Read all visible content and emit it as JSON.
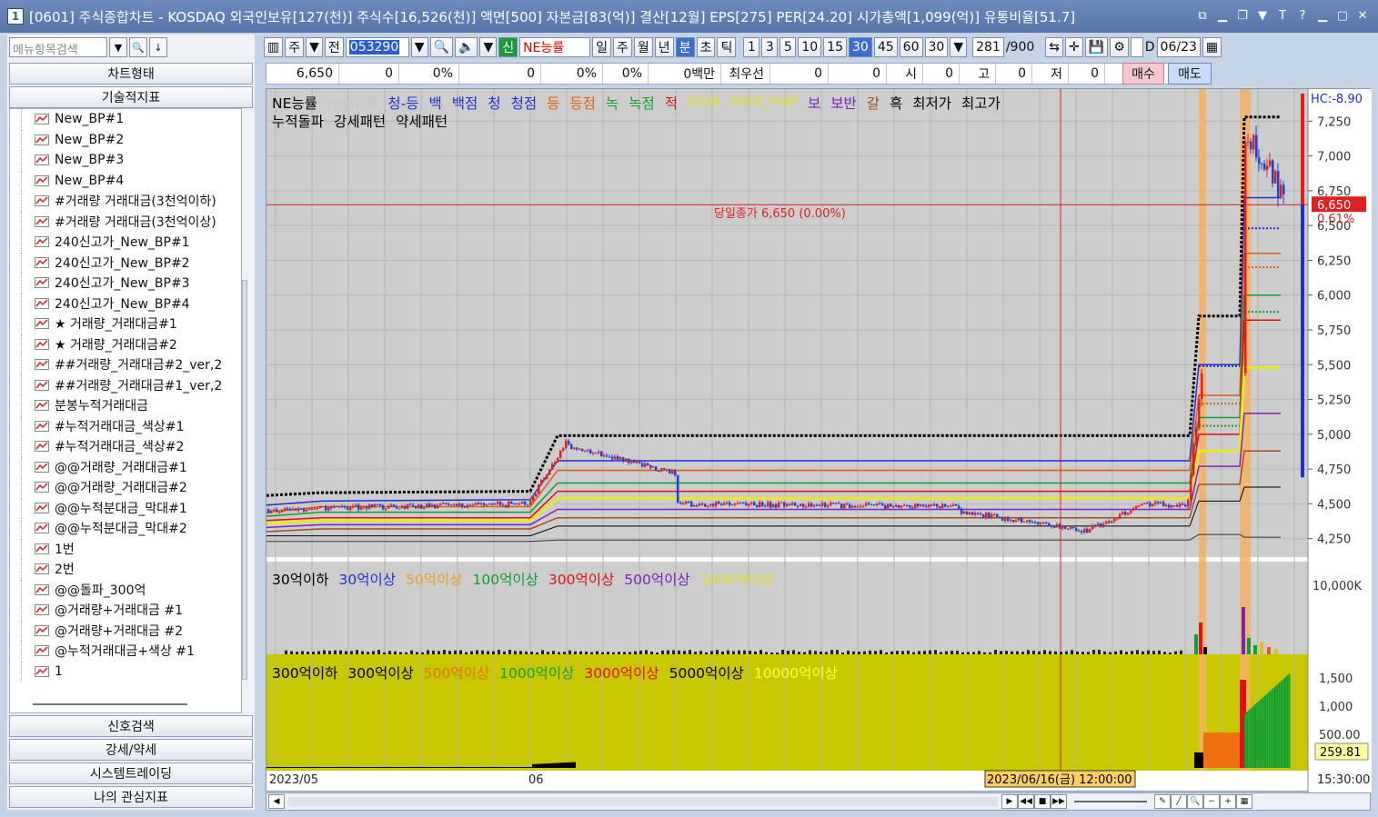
{
  "titlebar": {
    "badge": "1",
    "text": "[0601] 주식종합차트 - KOSDAQ 외국인보유[127(천)] 주식수[16,526(천)] 액면[500] 자본금[83(억)] 결산[12월] EPS[275] PER[24.20] 시가총액[1,099(억)] 유통비율[51.7]",
    "controls": [
      "⧉",
      "▁",
      "❐",
      "▼",
      "T",
      "?",
      "▁",
      "▢",
      "✕"
    ]
  },
  "leftpanel": {
    "search_placeholder": "메뉴항목검색",
    "chart_type_label": "차트형태",
    "tech_indicator_label": "기술적지표",
    "indicators": [
      "New_BP#1",
      "New_BP#2",
      "New_BP#3",
      "New_BP#4",
      "#거래량 거래대금(3천억이하)",
      "#거래량 거래대금(3천억이상)",
      "240신고가_New_BP#1",
      "240신고가_New_BP#2",
      "240신고가_New_BP#3",
      "240신고가_New_BP#4",
      "★ 거래량_거래대금#1",
      "★ 거래량_거래대금#2",
      "##거래량_거래대금#2_ver,2",
      "##거래량_거래대금#1_ver,2",
      "분봉누적거래대금",
      "#누적거래대금_색상#1",
      "#누적거래대금_색상#2",
      "@@거래량_거래대금#1",
      "@@거래량_거래대금#2",
      "@@누적분대금_막대#1",
      "@@누적분대금_막대#2",
      "1번",
      "2번",
      "@@돌파_300억",
      "@거래량+거래대금 #1",
      "@거래량+거래대금 #2",
      "@누적거래대금+색상 #1",
      "1"
    ],
    "bottom_buttons": [
      "신호검색",
      "강세/약세",
      "시스템트레이딩",
      "나의 관심지표"
    ]
  },
  "toolbar": {
    "stock_type": "주",
    "prev": "전",
    "code": "053290",
    "credit": "신",
    "indicator_name": "NE능률",
    "periods": [
      "일",
      "주",
      "월",
      "년",
      "분",
      "초",
      "틱"
    ],
    "active_period": "분",
    "intervals": [
      "1",
      "3",
      "5",
      "10",
      "15",
      "30",
      "45",
      "60"
    ],
    "active_interval": "30",
    "interval_select": "30",
    "count": "281",
    "count_total": "/900",
    "date_label": "D",
    "date_value": "06/23"
  },
  "pricebar": {
    "cells": [
      "6,650",
      "0",
      "0%",
      "0",
      "0%",
      "0%",
      "0백만",
      "최우선",
      "0",
      "0",
      "시",
      "0",
      "고",
      "0",
      "저",
      "0"
    ],
    "buy": "매수",
    "sell": "매도"
  },
  "chart": {
    "legend_top": [
      "NE능률",
      "High-청",
      "청-등",
      "백",
      "백점",
      "청",
      "청점",
      "등",
      "등점",
      "녹",
      "녹점",
      "적",
      "Gold",
      "Gold_Half",
      "보",
      "보반",
      "갈",
      "흑",
      "최저가",
      "최고가"
    ],
    "legend_top_colors": [
      "#000000",
      "#c8c8c8",
      "#2030d0",
      "#2030d0",
      "#2030d0",
      "#2030d0",
      "#2030d0",
      "#e06010",
      "#e06010",
      "#10a030",
      "#10a030",
      "#e01010",
      "#e0e020",
      "#e0e020",
      "#8020c0",
      "#8020c0",
      "#a05020",
      "#000000",
      "#000000",
      "#000000"
    ],
    "legend_top2": [
      "누적돌파",
      "강세패턴",
      "약세패턴"
    ],
    "close_label": "당일종가 6,650 (0.00%)",
    "hc_label": "HC:-8.90",
    "price_ticks": [
      "7,250",
      "7,000",
      "6,750",
      "6,500",
      "6,250",
      "6,000",
      "5,750",
      "5,500",
      "5,250",
      "5,000",
      "4,750",
      "4,500",
      "4,250"
    ],
    "price_box": "6,650",
    "pct_box": "0.61%",
    "legend_mid": [
      "30억이하",
      "30억이상",
      "50억이상",
      "100억이상",
      "300억이상",
      "500억이상",
      "1000억이상"
    ],
    "legend_mid_colors": [
      "#000000",
      "#2030d0",
      "#f0a020",
      "#10a030",
      "#e01010",
      "#8020c0",
      "#e0e020"
    ],
    "mid_tick": "10,000K",
    "legend_bot": [
      "300억이하",
      "300억이상",
      "500억이상",
      "1000억이상",
      "3000억이상",
      "5000억이상",
      "10000억이상"
    ],
    "legend_bot_colors": [
      "#000000",
      "#000000",
      "#f07010",
      "#10a030",
      "#e01010",
      "#000000",
      "#ffff40"
    ],
    "bot_ticks": [
      "1,500",
      "1,000",
      "500.00"
    ],
    "bot_box": "259.81",
    "x_labels": [
      "2023/05",
      "06"
    ],
    "cursor_date": "2023/06/16(금) 12:00:00",
    "time_label": "15:30:00"
  },
  "chart_data": {
    "type": "candlestick",
    "price_range": [
      4150,
      7350
    ],
    "current_price": 6650,
    "segments": [
      {
        "period": "2023/05 late",
        "approx_close": 4450
      },
      {
        "period": "2023/06 early",
        "approx_close": 4900
      },
      {
        "period": "2023/06 mid",
        "approx_close": 4500
      },
      {
        "period": "2023/06/16",
        "approx_close": 4300
      },
      {
        "period": "2023/06/22",
        "approx_close": 5400
      },
      {
        "period": "2023/06/23",
        "approx_close": 6650
      }
    ]
  }
}
